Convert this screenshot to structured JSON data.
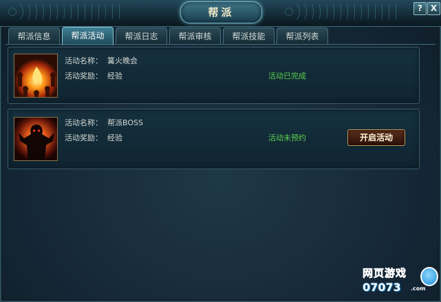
{
  "window": {
    "title": "帮派",
    "help_label": "?",
    "close_label": "X"
  },
  "tabs": [
    {
      "label": "帮派信息",
      "active": false
    },
    {
      "label": "帮派活动",
      "active": true
    },
    {
      "label": "帮派日志",
      "active": false
    },
    {
      "label": "帮派审核",
      "active": false
    },
    {
      "label": "帮派技能",
      "active": false
    },
    {
      "label": "帮派列表",
      "active": false
    }
  ],
  "activities": [
    {
      "icon": "bonfire-party-icon",
      "name_label": "活动名称：",
      "name": "篝火晚会",
      "reward_label": "活动奖励：",
      "reward": "经验",
      "status": "活动已完成"
    },
    {
      "icon": "guild-boss-icon",
      "name_label": "活动名称：",
      "name": "帮派BOSS",
      "reward_label": "活动奖励：",
      "reward": "经验",
      "status": "活动未预约",
      "button_label": "开启活动"
    }
  ],
  "watermark": {
    "line1": "网页游戏",
    "line2": "07073",
    "line3": ".com"
  },
  "colors": {
    "status_green": "#5cd04e",
    "frame_teal": "#3d6f80",
    "button_gold": "#c59a58"
  }
}
